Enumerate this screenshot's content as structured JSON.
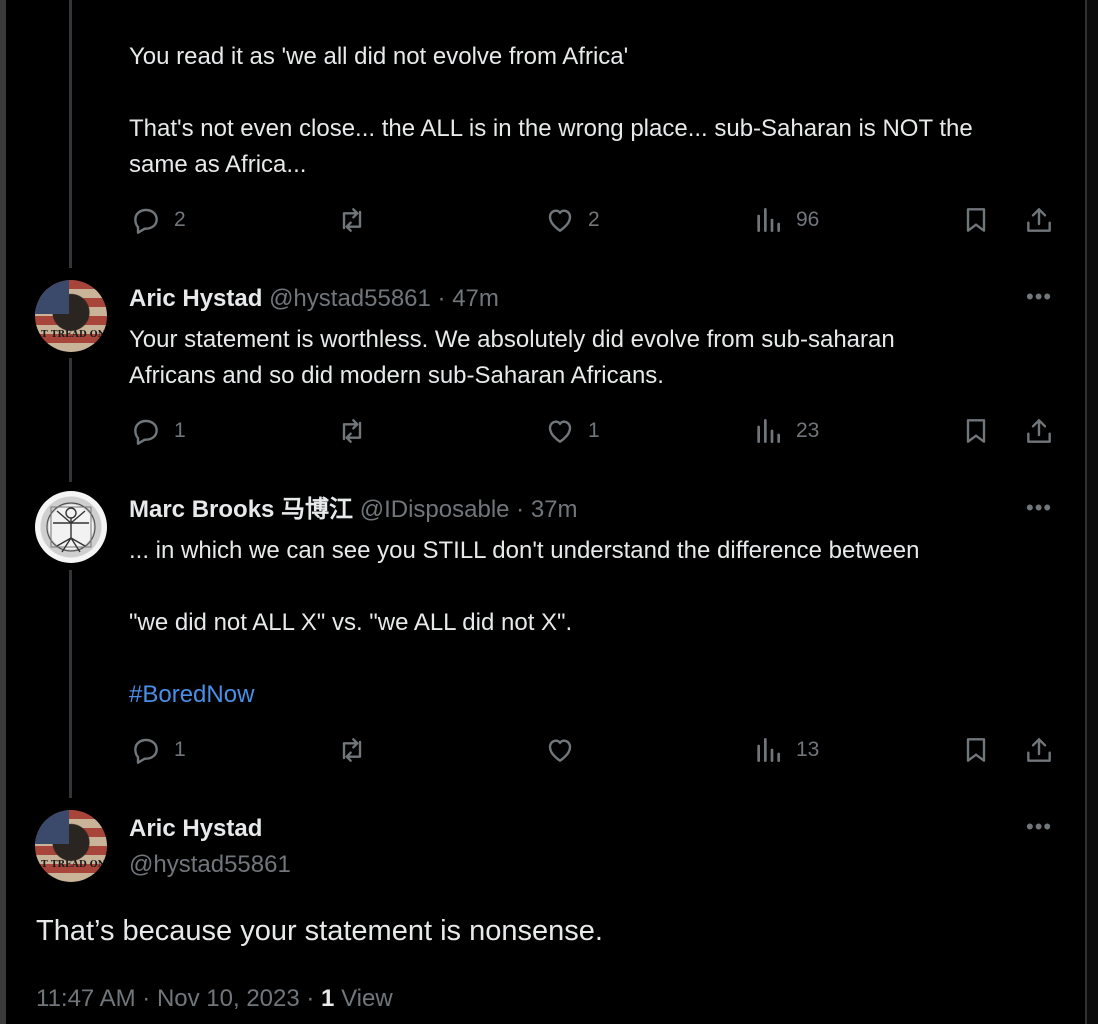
{
  "reply_0": {
    "lines": [
      "You read it as 'we all did not evolve from Africa'",
      "That's not even close... the ALL is in the wrong place... sub-Saharan is NOT the",
      "same as Africa..."
    ],
    "replies": "2",
    "likes": "2",
    "views": "96"
  },
  "reply_1": {
    "name": "Aric Hystad",
    "handle": "@hystad55861",
    "time": "· 47m",
    "lines": [
      "Your statement is worthless. We absolutely did evolve from sub-saharan",
      "Africans and so did modern sub-Saharan Africans."
    ],
    "replies": "1",
    "likes": "1",
    "views": "23",
    "avatar_text": "T TREAD ON"
  },
  "reply_2": {
    "name": "Marc Brooks 马博江",
    "handle": "@IDisposable",
    "time": "· 37m",
    "lines": [
      "... in which we can see you STILL don't understand the difference between",
      "\"we did not ALL X\" vs. \"we ALL did not X\"."
    ],
    "hashtag": "#BoredNow",
    "replies": "1",
    "likes": "",
    "views": "13"
  },
  "main_post": {
    "name": "Aric Hystad",
    "handle": "@hystad55861",
    "text": "That’s because your statement is nonsense.",
    "time": "11:47 AM · Nov 10, 2023 · ",
    "views_count": "1",
    "views_label": " View",
    "avatar_text": "T TREAD ON"
  },
  "more_label": "•••",
  "colors": {
    "background": "#000000",
    "text": "#e7e9ea",
    "secondary": "#71767b",
    "link": "#4a8fe7"
  },
  "icons": [
    "reply-icon",
    "retweet-icon",
    "like-icon",
    "views-icon",
    "bookmark-icon",
    "share-icon",
    "more-icon"
  ]
}
